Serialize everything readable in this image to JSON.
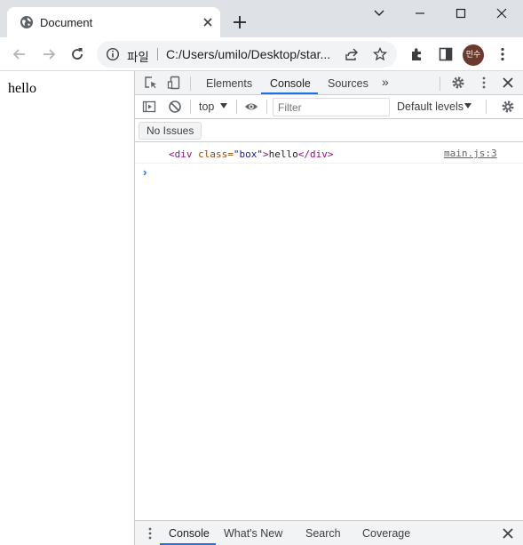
{
  "tab": {
    "title": "Document",
    "favicon": "globe-icon"
  },
  "omnibox": {
    "scheme_label": "파일",
    "url": "C:/Users/umilo/Desktop/star..."
  },
  "profile": {
    "initials": "민수",
    "color": "#6b3a2e"
  },
  "page": {
    "text": "hello"
  },
  "devtools": {
    "tabs": [
      "Elements",
      "Console",
      "Sources"
    ],
    "active_tab": "Console",
    "more_tabs_glyph": "»",
    "console": {
      "context": "top",
      "filter_placeholder": "Filter",
      "levels": "Default levels",
      "issues_button": "No Issues",
      "log": {
        "open_tag_start": "<div",
        "attr_name": " class=",
        "attr_value": "\"box\"",
        "open_tag_end": ">",
        "text": "hello",
        "close_tag": "</div>",
        "source": "main.js:3"
      },
      "prompt_glyph": "›"
    },
    "drawer": {
      "tabs": [
        "Console",
        "What's New",
        "Search",
        "Coverage"
      ],
      "active_tab": "Console"
    }
  },
  "colors": {
    "accent": "#1a73e8",
    "tag": "#881280",
    "attr_name": "#994500",
    "attr_value": "#1a1aa6"
  }
}
